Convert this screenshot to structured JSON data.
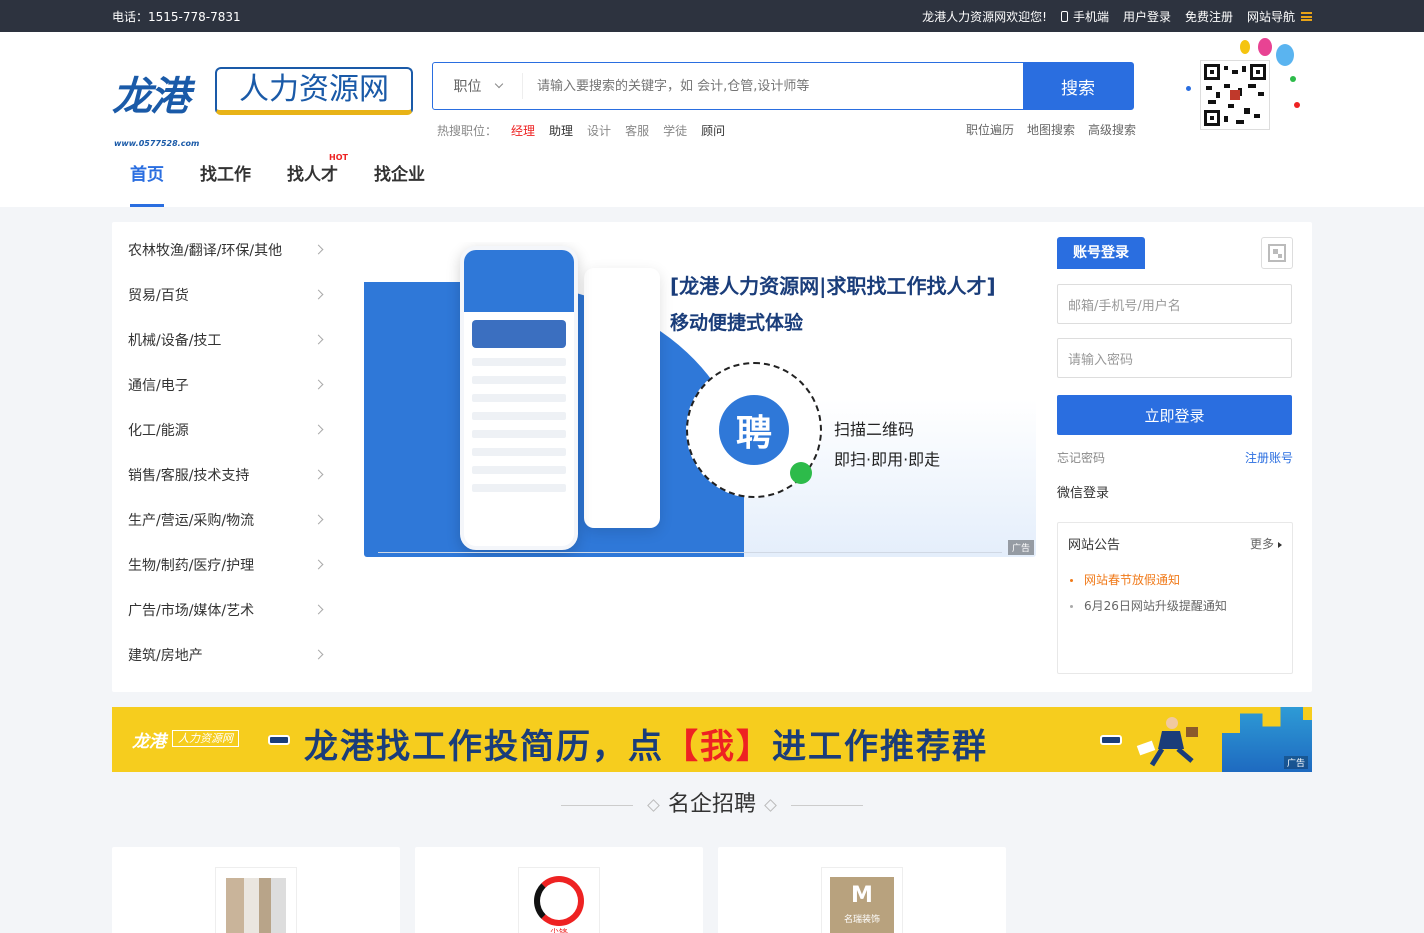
{
  "topbar": {
    "phone": "电话：1515-778-7831",
    "welcome": "龙港人力资源网欢迎您!",
    "mobile": "手机端",
    "login": "用户登录",
    "register": "免费注册",
    "site_nav": "网站导航"
  },
  "logo": {
    "big": "龙港",
    "box": "人力资源网",
    "url": "www.0577528.com"
  },
  "search": {
    "select": "职位",
    "placeholder": "请输入要搜索的关键字，如 会计,仓管,设计师等",
    "button": "搜索"
  },
  "hot": {
    "label": "热搜职位：",
    "items": [
      "经理",
      "助理",
      "设计",
      "客服",
      "学徒",
      "顾问"
    ]
  },
  "links": [
    "职位遍历",
    "地图搜索",
    "高级搜索"
  ],
  "nav": {
    "items": [
      "首页",
      "找工作",
      "找人才",
      "找企业"
    ],
    "badge": "HOT"
  },
  "categories": [
    "农林牧渔/翻译/环保/其他",
    "贸易/百货",
    "机械/设备/技工",
    "通信/电子",
    "化工/能源",
    "销售/客服/技术支持",
    "生产/营运/采购/物流",
    "生物/制药/医疗/护理",
    "广告/市场/媒体/艺术",
    "建筑/房地产"
  ],
  "banner": {
    "title": "[龙港人力资源网|求职找工作找人才]",
    "subtitle": "移动便捷式体验",
    "qr_char": "聘",
    "scan": "扫描二维码",
    "tagline": "即扫·即用·即走",
    "ad": "广告"
  },
  "login": {
    "tab": "账号登录",
    "user_placeholder": "邮箱/手机号/用户名",
    "pass_placeholder": "请输入密码",
    "submit": "立即登录",
    "forgot": "忘记密码",
    "register": "注册账号",
    "wechat": "微信登录"
  },
  "notice": {
    "title": "网站公告",
    "more": "更多",
    "items": [
      "网站春节放假通知",
      "6月26日网站升级提醒通知"
    ]
  },
  "promo": {
    "logo_big": "龙港",
    "logo_box": "人力资源网",
    "text_a": "龙港找工作投简历，点",
    "text_me": "【我】",
    "text_b": "进工作推荐群",
    "ad": "广告"
  },
  "section": {
    "title": "名企招聘"
  },
  "cards": {
    "c2_logo": "尖锋",
    "c3_logo": "M",
    "c3_sub": "名瑞装饰"
  },
  "colors": {
    "primary": "#2a6ee0",
    "topbar": "#2d333f",
    "accent_red": "#e22222",
    "promo": "#f6cd1e"
  }
}
